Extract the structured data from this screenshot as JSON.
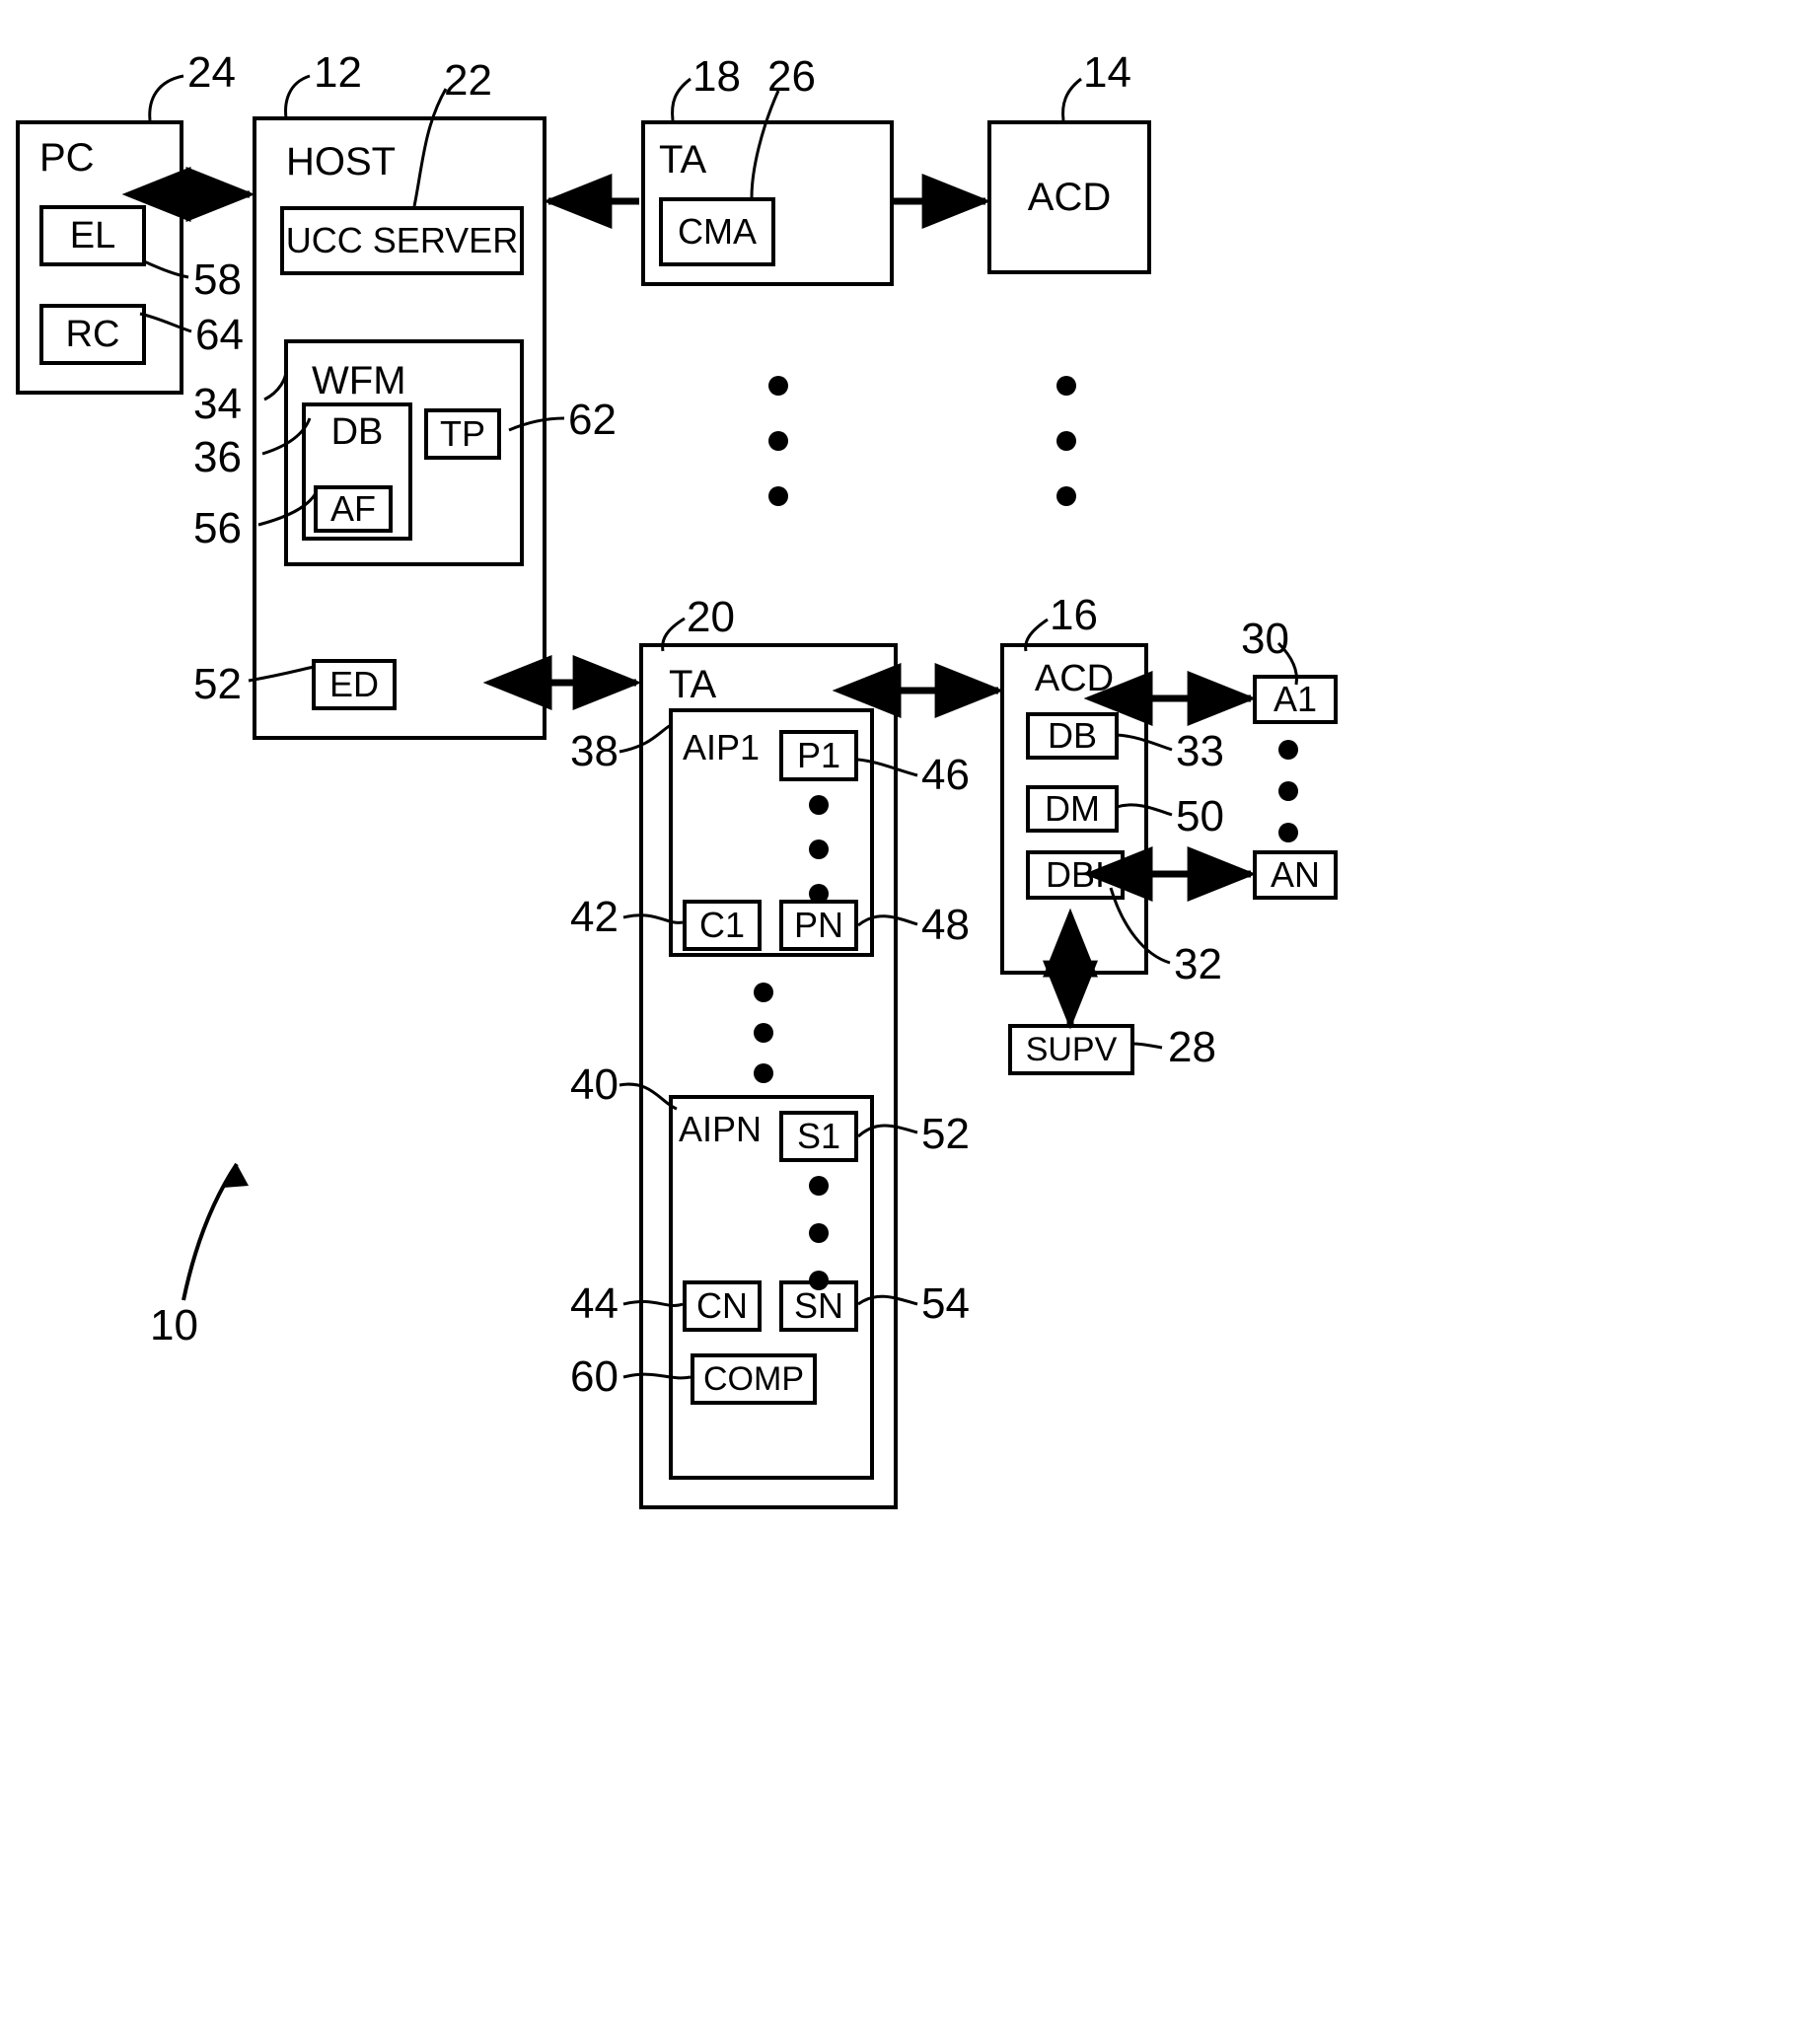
{
  "figure": {
    "type": "patent-block-diagram",
    "figure_ref": "10"
  },
  "blocks": [
    {
      "id": "pc",
      "label": "PC",
      "ref": "24"
    },
    {
      "id": "el",
      "label": "EL",
      "ref": "58"
    },
    {
      "id": "rc",
      "label": "RC",
      "ref": "64"
    },
    {
      "id": "host",
      "label": "HOST",
      "ref": "12"
    },
    {
      "id": "ucc",
      "label": "UCC SERVER",
      "ref": "22"
    },
    {
      "id": "wfm",
      "label": "WFM",
      "ref": "34"
    },
    {
      "id": "db_wfm",
      "label": "DB",
      "ref": "36"
    },
    {
      "id": "af",
      "label": "AF",
      "ref": "56"
    },
    {
      "id": "tp",
      "label": "TP",
      "ref": "62"
    },
    {
      "id": "ed",
      "label": "ED",
      "ref": "52"
    },
    {
      "id": "ta_top",
      "label": "TA",
      "ref": "18"
    },
    {
      "id": "cma",
      "label": "CMA",
      "ref": "26"
    },
    {
      "id": "acd_top",
      "label": "ACD",
      "ref": "14"
    },
    {
      "id": "ta_bottom",
      "label": "TA",
      "ref": "20"
    },
    {
      "id": "aip1",
      "label": "AIP1",
      "ref": "38"
    },
    {
      "id": "p1",
      "label": "P1",
      "ref": "46"
    },
    {
      "id": "pn",
      "label": "PN",
      "ref": "48"
    },
    {
      "id": "c1",
      "label": "C1",
      "ref": "42"
    },
    {
      "id": "aipn",
      "label": "AIPN",
      "ref": "40"
    },
    {
      "id": "s1",
      "label": "S1",
      "ref": "52"
    },
    {
      "id": "sn",
      "label": "SN",
      "ref": "54"
    },
    {
      "id": "cn",
      "label": "CN",
      "ref": "44"
    },
    {
      "id": "comp",
      "label": "COMP",
      "ref": "60"
    },
    {
      "id": "acd_main",
      "label": "ACD",
      "ref": "16"
    },
    {
      "id": "db_acd",
      "label": "DB",
      "ref": "33"
    },
    {
      "id": "dm",
      "label": "DM",
      "ref": "50"
    },
    {
      "id": "dbi",
      "label": "DBI",
      "ref": "32"
    },
    {
      "id": "a1",
      "label": "A1",
      "ref": "30"
    },
    {
      "id": "an",
      "label": "AN",
      "ref": ""
    },
    {
      "id": "supv",
      "label": "SUPV",
      "ref": "28"
    }
  ],
  "labels": {
    "pc": "PC",
    "el": "EL",
    "rc": "RC",
    "host": "HOST",
    "ucc_server": "UCC SERVER",
    "wfm": "WFM",
    "db_wfm": "DB",
    "af": "AF",
    "tp": "TP",
    "ed": "ED",
    "ta_top": "TA",
    "cma": "CMA",
    "acd_top": "ACD",
    "ta_bottom": "TA",
    "aip1": "AIP1",
    "p1": "P1",
    "pn": "PN",
    "c1": "C1",
    "aipn": "AIPN",
    "s1": "S1",
    "sn": "SN",
    "cn": "CN",
    "comp": "COMP",
    "acd_main": "ACD",
    "db_acd": "DB",
    "dm": "DM",
    "dbi": "DBI",
    "a1": "A1",
    "an": "AN",
    "supv": "SUPV"
  },
  "refs": {
    "r10": "10",
    "r12": "12",
    "r14": "14",
    "r16": "16",
    "r18": "18",
    "r20": "20",
    "r22": "22",
    "r24": "24",
    "r26": "26",
    "r28": "28",
    "r30": "30",
    "r32": "32",
    "r33": "33",
    "r34": "34",
    "r36": "36",
    "r38": "38",
    "r40": "40",
    "r42": "42",
    "r44": "44",
    "r46": "46",
    "r48": "48",
    "r50": "50",
    "r52_ed": "52",
    "r52_s1": "52",
    "r54": "54",
    "r56": "56",
    "r58": "58",
    "r60": "60",
    "r62": "62",
    "r64": "64"
  },
  "colors": {
    "stroke": "#000000",
    "background": "#ffffff"
  }
}
